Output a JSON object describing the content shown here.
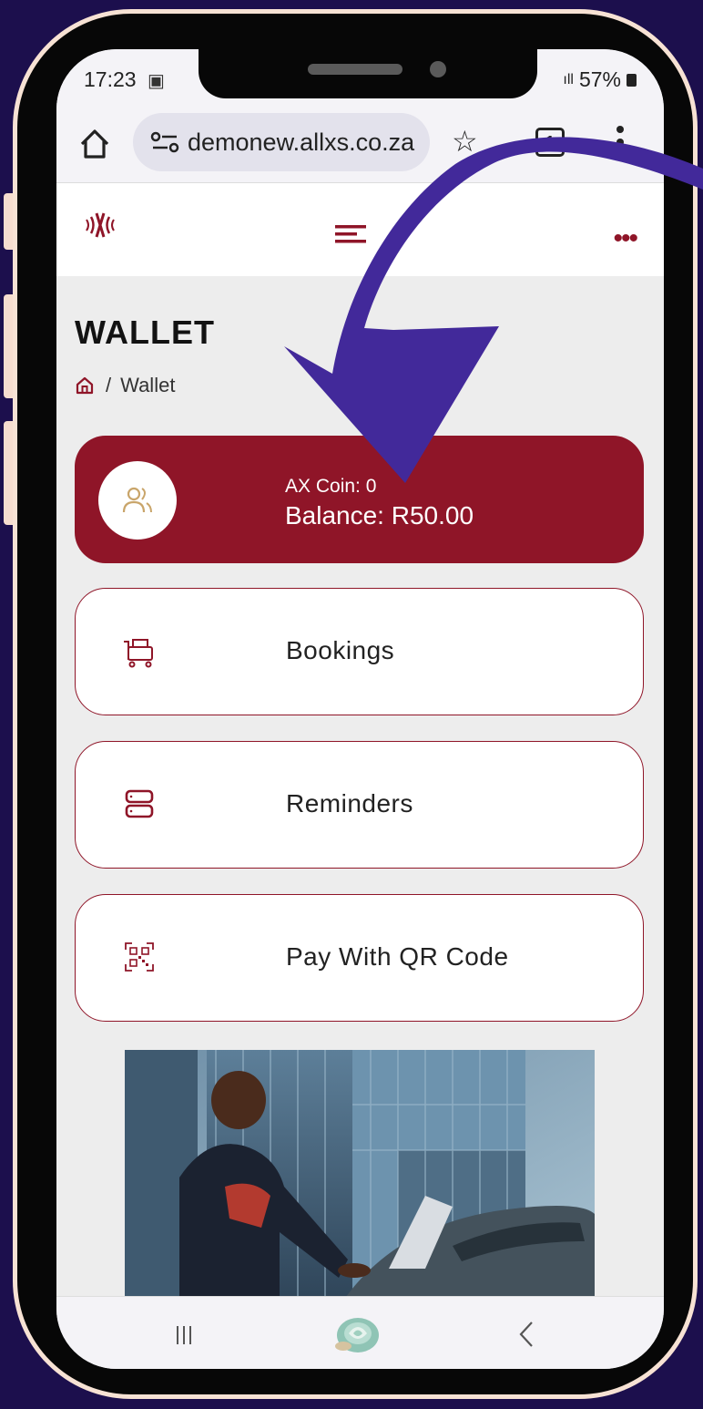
{
  "status_bar": {
    "time": "17:23",
    "battery": "57%"
  },
  "browser": {
    "url": "demonew.allxs.co.za",
    "tab_count": "1"
  },
  "page": {
    "title": "WALLET",
    "breadcrumb_separator": "/",
    "breadcrumb_current": "Wallet"
  },
  "balance_card": {
    "coin_text": "AX Coin: 0",
    "balance_text": "Balance: R50.00"
  },
  "menu_items": [
    {
      "label": "Bookings",
      "icon": "hotel-cart-icon"
    },
    {
      "label": "Reminders",
      "icon": "server-stack-icon"
    },
    {
      "label": "Pay With QR Code",
      "icon": "qr-code-icon"
    }
  ],
  "colors": {
    "brand": "#8f1528",
    "background": "#1c0f4d",
    "frame": "#f7e2d4",
    "arrow": "#42299a"
  }
}
